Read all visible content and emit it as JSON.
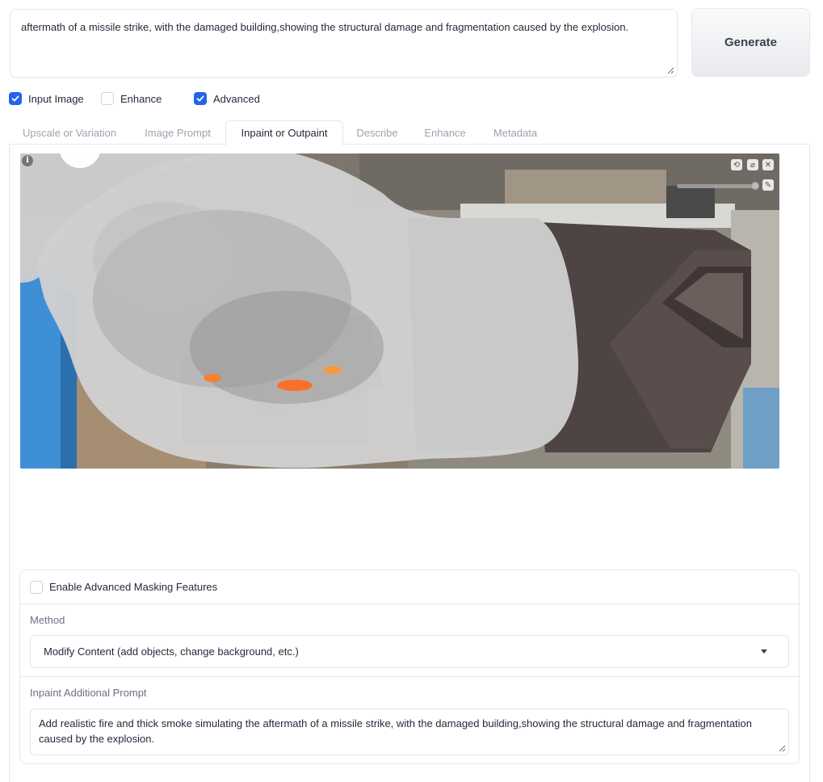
{
  "prompt": {
    "value": "aftermath of a missile strike, with the damaged building,showing the structural damage and fragmentation caused by the explosion."
  },
  "generate": {
    "label": "Generate"
  },
  "options": [
    {
      "label": "Input Image",
      "checked": true
    },
    {
      "label": "Enhance",
      "checked": false
    },
    {
      "label": "Advanced",
      "checked": true
    }
  ],
  "tabs": [
    {
      "label": "Upscale or Variation",
      "active": false
    },
    {
      "label": "Image Prompt",
      "active": false
    },
    {
      "label": "Inpaint or Outpaint",
      "active": true
    },
    {
      "label": "Describe",
      "active": false
    },
    {
      "label": "Enhance",
      "active": false
    },
    {
      "label": "Metadata",
      "active": false
    }
  ],
  "canvas": {
    "info_icon": "info-icon",
    "tool_icons": [
      "undo-icon",
      "clear-icon",
      "close-icon",
      "brush-icon"
    ],
    "info_glyph": "i",
    "undo_glyph": "⟲",
    "clear_glyph": "⌀",
    "close_glyph": "✕",
    "brush_glyph": "✎"
  },
  "masking": {
    "enable_label": "Enable Advanced Masking Features",
    "enable_checked": false,
    "method_label": "Method",
    "method_value": "Modify Content (add objects, change background, etc.)",
    "additional_label": "Inpaint Additional Prompt",
    "additional_value": "Add realistic fire and thick smoke simulating the aftermath of a missile strike, with the damaged building,showing the structural damage and fragmentation caused by the explosion."
  },
  "colors": {
    "accent": "#2563eb",
    "border": "#e5e7eb",
    "muted_text": "#9ca3af"
  }
}
